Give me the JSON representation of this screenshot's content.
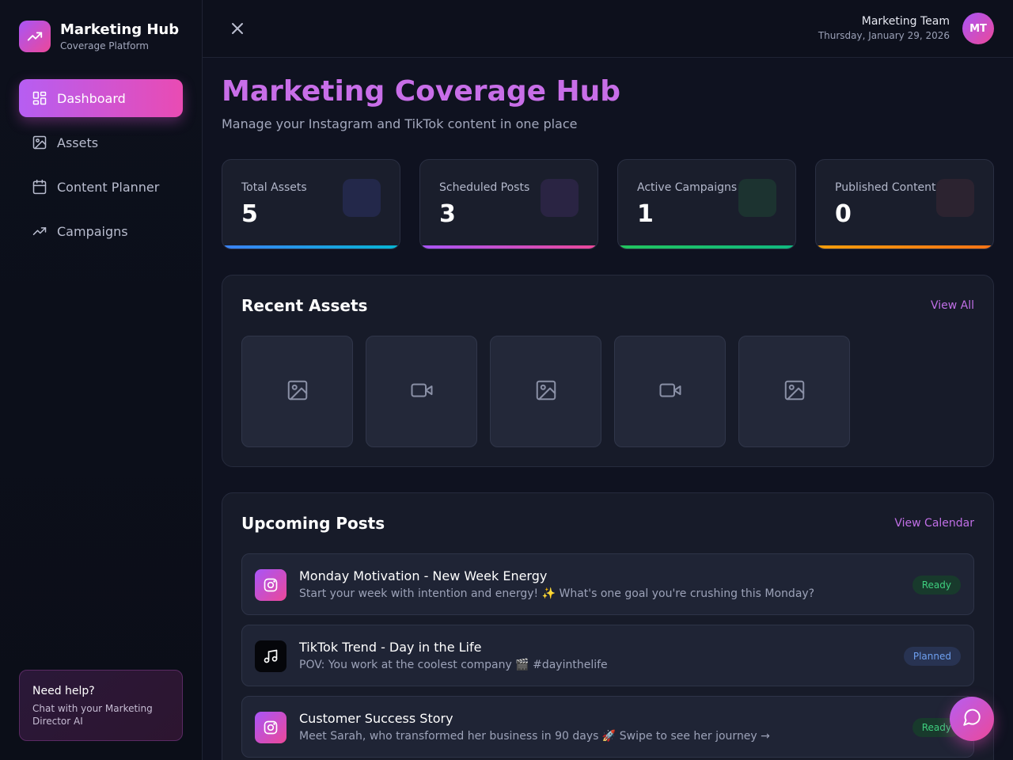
{
  "brand": {
    "title": "Marketing Hub",
    "subtitle": "Coverage Platform"
  },
  "nav": {
    "items": [
      {
        "label": "Dashboard",
        "icon": "dashboard-icon",
        "active": true
      },
      {
        "label": "Assets",
        "icon": "image-icon",
        "active": false
      },
      {
        "label": "Content Planner",
        "icon": "calendar-icon",
        "active": false
      },
      {
        "label": "Campaigns",
        "icon": "trending-up-icon",
        "active": false
      }
    ]
  },
  "help": {
    "title": "Need help?",
    "text": "Chat with your Marketing Director AI"
  },
  "header": {
    "user_name": "Marketing Team",
    "date": "Thursday, January 29, 2026",
    "avatar_initials": "MT"
  },
  "page": {
    "title": "Marketing Coverage Hub",
    "subtitle": "Manage your Instagram and TikTok content in one place"
  },
  "stats": [
    {
      "label": "Total Assets",
      "value": "5",
      "accent": "#3b82f6"
    },
    {
      "label": "Scheduled Posts",
      "value": "3",
      "accent": "#a855f7"
    },
    {
      "label": "Active Campaigns",
      "value": "1",
      "accent": "#22c55e"
    },
    {
      "label": "Published Content",
      "value": "0",
      "accent": "#f97316"
    }
  ],
  "recent_assets": {
    "title": "Recent Assets",
    "link": "View All",
    "items": [
      {
        "type": "image",
        "icon": "image-icon"
      },
      {
        "type": "video",
        "icon": "video-icon"
      },
      {
        "type": "image",
        "icon": "image-icon"
      },
      {
        "type": "video",
        "icon": "video-icon"
      },
      {
        "type": "image",
        "icon": "image-icon"
      }
    ]
  },
  "upcoming_posts": {
    "title": "Upcoming Posts",
    "link": "View Calendar",
    "items": [
      {
        "platform": "instagram",
        "icon": "instagram-icon",
        "title": "Monday Motivation - New Week Energy",
        "description": "Start your week with intention and energy! ✨ What's one goal you're crushing this Monday?",
        "status": "Ready"
      },
      {
        "platform": "tiktok",
        "icon": "music-note-icon",
        "title": "TikTok Trend - Day in the Life",
        "description": "POV: You work at the coolest company 🎬 #dayinthelife",
        "status": "Planned"
      },
      {
        "platform": "instagram",
        "icon": "instagram-icon",
        "title": "Customer Success Story",
        "description": "Meet Sarah, who transformed her business in 90 days 🚀 Swipe to see her journey →",
        "status": "Ready"
      }
    ]
  },
  "colors": {
    "accent_purple": "#a855f7",
    "accent_pink": "#ec4899",
    "background": "#0f1220"
  }
}
